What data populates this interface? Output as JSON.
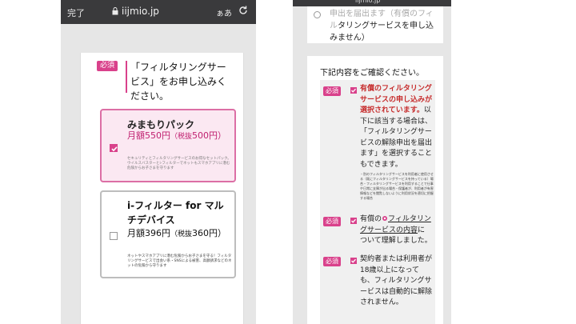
{
  "left": {
    "status": {
      "done_label": "完了",
      "url": "iijmio.jp",
      "text_size_label": "ぁあ"
    },
    "question": {
      "badge": "必須",
      "text": "「フィルタリングサービス」をお申し込みください。"
    },
    "options": [
      {
        "title": "みまもりパック",
        "price_prefix": "月額550円",
        "tax_label": "（税抜",
        "tax_value": "500",
        "tax_suffix": "円）",
        "selected": true,
        "desc": "セキュリティとフィルタリングサービスのお得なセットパック。ウイルスバスターとi-フィルターでネットもスマホアプリに潜む危険からお子さまを守ります"
      },
      {
        "title": "i-フィルター for マルチデバイス",
        "price_prefix": "月額396円",
        "tax_label": "（税抜",
        "tax_value": "360",
        "tax_suffix": "円）",
        "selected": false,
        "desc": "ネットやスマホアプリに潜む危険からお子さまを守る！フィルタリングサービスで出会い系・SNSによる被害、高額請求などのネットの危険から守ります"
      }
    ]
  },
  "right": {
    "top_option": {
      "text_cut": "申出を届出ます（有償のフィル",
      "text": "タリングサービスを申し込みません）"
    },
    "confirm_heading": "下記内容をご確認ください。",
    "items": [
      {
        "badge": "必須",
        "highlight": "有償のフィルタリングサービスの申し込みが選択されています。",
        "text": "以下に該当する場合は、「フィルタリングサービスの解除申出を届出ます」を選択することもできます。",
        "small": "・別のフィルタリングサービスを利用者に使用させる（既にフィルタリングサービスを持っている）場合・フィルタリングサービスを利用することで仕事や日常に支障が出る場合・保護者が、利用者が有害情報などを閲覧しないように利用状況を適切に把握する場合"
      },
      {
        "badge": "必須",
        "prefix": "有償の",
        "link": "フィルタリングサービスの内容",
        "suffix": "について理解しました。"
      },
      {
        "badge": "必須",
        "text": "契約者または利用者が18歳以上になっても、フィルタリングサービスは自動的に解除されません。"
      }
    ]
  },
  "colors": {
    "accent": "#d9418b",
    "selected_bg": "#fbe8f2",
    "warning_text": "#c62b2b"
  },
  "icons": [
    "lock-icon",
    "reload-icon",
    "checkbox-checked-icon",
    "checkbox-empty-icon",
    "radio-icon",
    "gear-icon"
  ]
}
